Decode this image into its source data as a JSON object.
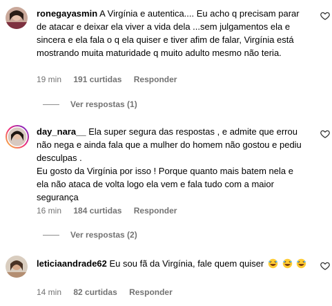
{
  "comments": [
    {
      "username": "ronegayasmin",
      "text": "A Virgínia e autentica.... Eu acho q precisam parar de atacar e deixar ela viver a vida dela ...sem julgamentos ela e sincera e ela fala o q ela quiser e tiver afim de falar, Virgínia está mostrando muita maturidade q muito adulto mesmo não teria.",
      "time": "19 min",
      "likes": "191 curtidas",
      "reply": "Responder",
      "view_replies": "Ver respostas (1)"
    },
    {
      "username": "day_nara__",
      "text_line1": "Ela super segura das respostas , e admite que errou não nega e ainda fala que a mulher do homem não gostou e pediu desculpas .",
      "text_line2": "Eu gosto da Virgínia por isso ! Porque quanto mais batem nela e ela não ataca de volta logo ela vem e fala tudo com a maior segurança",
      "time": "16 min",
      "likes": "184 curtidas",
      "reply": "Responder",
      "view_replies": "Ver respostas (2)"
    },
    {
      "username": "leticiaandrade62",
      "text": "Eu sou fã da Virgínia, fale quem quiser",
      "emoji_name": "rolling-on-floor-laughing-emoji",
      "time": "14 min",
      "likes": "82 curtidas",
      "reply": "Responder"
    }
  ]
}
